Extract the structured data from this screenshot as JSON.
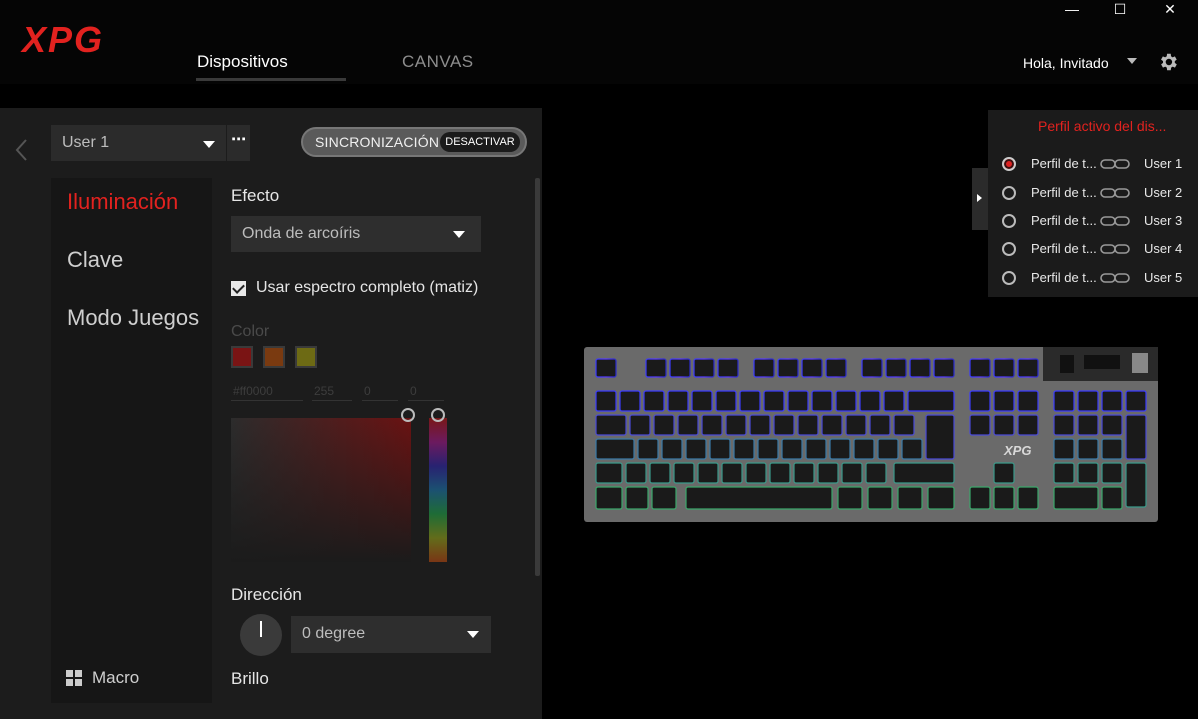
{
  "app": {
    "logo_text": "XPG"
  },
  "nav": {
    "tabs": [
      {
        "label": "Dispositivos",
        "active": true
      },
      {
        "label": "CANVAS",
        "active": false
      }
    ]
  },
  "header": {
    "greeting": "Hola, Invitado"
  },
  "window_controls": {
    "minimize": "—",
    "maximize": "☐",
    "close": "✕"
  },
  "profile": {
    "selected": "User 1",
    "more": "⋯"
  },
  "sync": {
    "label": "SINCRONIZACIÓN",
    "button": "DESACTIVAR"
  },
  "sidebar": {
    "items": [
      {
        "label": "Iluminación",
        "active": true
      },
      {
        "label": "Clave",
        "active": false
      },
      {
        "label": "Modo Juegos",
        "active": false
      }
    ],
    "macro": "Macro"
  },
  "lighting": {
    "effect_title": "Efecto",
    "effect_value": "Onda de arcoíris",
    "checkbox_label": "Usar espectro completo (matiz)",
    "checkbox_checked": true,
    "color_title": "Color",
    "swatches": [
      "#7a1414",
      "#7a3a10",
      "#6d6a14"
    ],
    "hex_value": "#ff0000",
    "r": "255",
    "g": "0",
    "b": "0",
    "direction_title": "Dirección",
    "direction_value": "0 degree",
    "brightness_title": "Brillo"
  },
  "profiles_popup": {
    "title": "Perfil activo del dis...",
    "rows": [
      {
        "name": "Perfil de t...",
        "user": "User 1",
        "active": true
      },
      {
        "name": "Perfil de t...",
        "user": "User 2",
        "active": false
      },
      {
        "name": "Perfil de t...",
        "user": "User 3",
        "active": false
      },
      {
        "name": "Perfil de t...",
        "user": "User 4",
        "active": false
      },
      {
        "name": "Perfil de t...",
        "user": "User 5",
        "active": false
      }
    ]
  },
  "keyboard": {
    "brand": "XPG"
  }
}
